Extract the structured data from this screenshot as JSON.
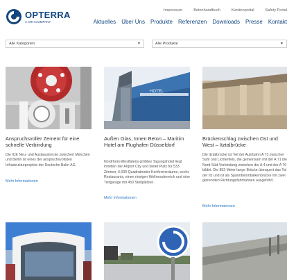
{
  "brand": {
    "name": "OPTERRA",
    "tagline": "A CRH COMPANY",
    "color": "#13467f"
  },
  "meta_nav": [
    "Impressum",
    "Betonhandbuch",
    "Kundenportal",
    "Safety Portal"
  ],
  "main_nav": [
    "Aktuelles",
    "Über Uns",
    "Produkte",
    "Referenzen",
    "Downloads",
    "Presse",
    "Kontakt"
  ],
  "filters": {
    "category": "Alle Kategorien",
    "product": "Alle Produkte"
  },
  "cards": [
    {
      "title": "Anspruchsvoller Zement für eine schnelle Verbindung",
      "text": "Die ICE Neu- und Ausbaustrecke zwischen München und Berlin ist eines der anspruchsvollsten Infrastrukturprojekte der Deutsche Bahn AG.",
      "link": "Mehr Informationen"
    },
    {
      "title": "Außen Glas, Innen Beton – Maritim Hotel am Flughafen Düsseldorf",
      "text": "Nordrhein-Westfalens größtes Tagungshotel liegt inmitten der Airport City und bietet Platz für 533 Zimmer, 6.000 Quadratmeter Konferenzräume, sechs Restaurants, einen riesigen Wellnessbereich und eine Tiefgarage mit 450 Stellplätzen.",
      "link": "Mehr Informationen"
    },
    {
      "title": "Brückenschlag zwischen Ost und West – Itztalbrücke",
      "text": "Die Itztalbrücke ist Teil der Autobahn A 73 zwischen Suhl und Lichtenfels, die gemeinsam mit der A 71 die Nord-Süd-Verbindung zwischen der A 4 und der A 70 bildet. Die 852 Meter lange Brücke überquert das Tal der Itz und ist als Spannbetonbalkenbrücke mit zwei getrennten Richtungsfahrbahnen ausgeführt.",
      "link": "Mehr Informationen"
    },
    {
      "title": "",
      "text": "",
      "link": ""
    },
    {
      "title": "",
      "text": "",
      "link": ""
    },
    {
      "title": "",
      "text": "",
      "link": ""
    }
  ]
}
